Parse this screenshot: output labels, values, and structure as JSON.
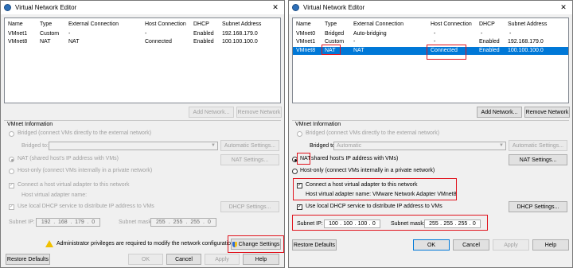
{
  "left": {
    "title": "Virtual Network Editor",
    "columns": [
      "Name",
      "Type",
      "External Connection",
      "Host Connection",
      "DHCP",
      "Subnet Address"
    ],
    "rows": [
      [
        "VMnet1",
        "Custom",
        "-",
        "-",
        "Enabled",
        "192.168.179.0"
      ],
      [
        "VMnet8",
        "NAT",
        "NAT",
        "Connected",
        "Enabled",
        "100.100.100.0"
      ]
    ],
    "add_network": "Add Network...",
    "remove_network": "Remove Network",
    "vmnet_info": "VMnet Information",
    "bridged": "Bridged (connect VMs directly to the external network)",
    "bridged_to": "Bridged to:",
    "automatic_settings": "Automatic Settings...",
    "nat": "NAT (shared host's IP address with VMs)",
    "nat_settings": "NAT Settings...",
    "hostonly": "Host-only (connect VMs internally in a private network)",
    "connect_adapter": "Connect a host virtual adapter to this network",
    "adapter_name": "Host virtual adapter name:",
    "dhcp_check": "Use local DHCP service to distribute IP address to VMs",
    "dhcp_settings": "DHCP Settings...",
    "subnet_ip_label": "Subnet IP:",
    "subnet_ip": [
      "192",
      "168",
      "179",
      "0"
    ],
    "subnet_mask_label": "Subnet mask:",
    "subnet_mask": [
      "255",
      "255",
      "255",
      "0"
    ],
    "admin_msg": "Administrator privileges are required to modify the network configuration.",
    "change_settings": "Change Settings",
    "restore": "Restore Defaults",
    "ok": "OK",
    "cancel": "Cancel",
    "apply": "Apply",
    "help": "Help"
  },
  "right": {
    "title": "Virtual Network Editor",
    "columns": [
      "Name",
      "Type",
      "External Connection",
      "Host Connection",
      "DHCP",
      "Subnet Address"
    ],
    "rows": [
      [
        "VMnet0",
        "Bridged",
        "Auto-bridging",
        "-",
        "-",
        "-"
      ],
      [
        "VMnet1",
        "Custom",
        "-",
        "-",
        "Enabled",
        "192.168.179.0"
      ],
      [
        "VMnet8",
        "NAT",
        "NAT",
        "Connected",
        "Enabled",
        "100.100.100.0"
      ]
    ],
    "add_network": "Add Network...",
    "remove_network": "Remove Network",
    "vmnet_info": "VMnet Information",
    "bridged": "Bridged (connect VMs directly to the external network)",
    "bridged_to": "Bridged to:",
    "bridged_value": "Automatic",
    "automatic_settings": "Automatic Settings...",
    "nat_label": "NAT",
    "nat_rest": "shared host's IP address with VMs)",
    "nat_settings": "NAT Settings...",
    "hostonly": "Host-only (connect VMs internally in a private network)",
    "connect_adapter": "Connect a host virtual adapter to this network",
    "adapter_name": "Host virtual adapter name: VMware Network Adapter VMnet8",
    "dhcp_check": "Use local DHCP service to distribute IP address to VMs",
    "dhcp_settings": "DHCP Settings...",
    "subnet_ip_label": "Subnet IP:",
    "subnet_ip": [
      "100",
      "100",
      "100",
      "0"
    ],
    "subnet_mask_label": "Subnet mask:",
    "subnet_mask": [
      "255",
      "255",
      "255",
      "0"
    ],
    "restore": "Restore Defaults",
    "ok": "OK",
    "cancel": "Cancel",
    "apply": "Apply",
    "help": "Help"
  },
  "colors": {
    "selection": "#0078d7",
    "highlight": "#e0141e",
    "warning": "#f0c000"
  }
}
